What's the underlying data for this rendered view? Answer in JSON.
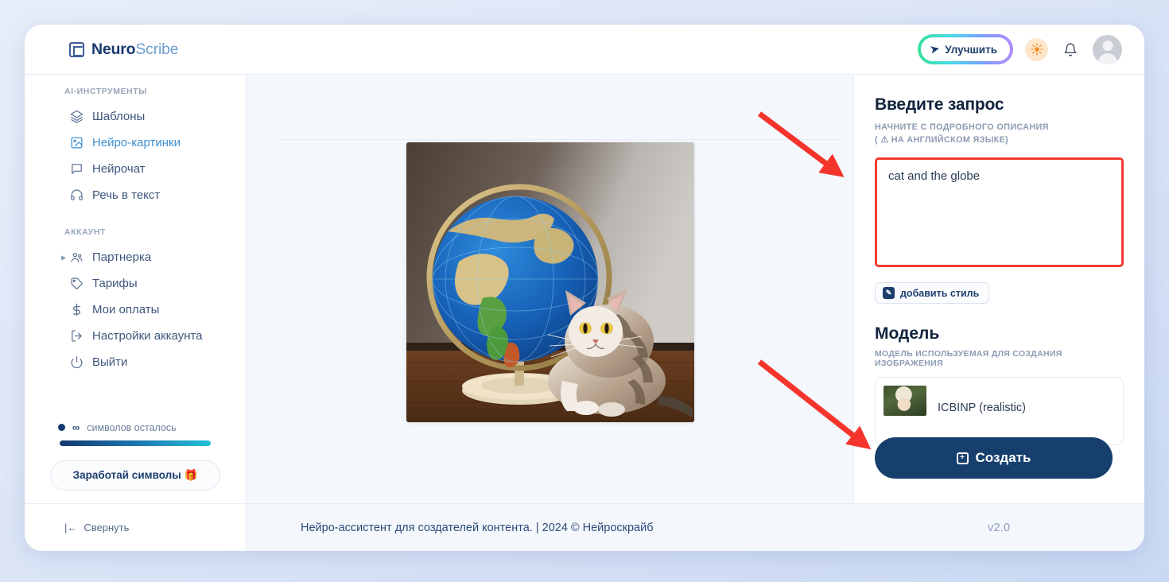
{
  "brand": {
    "name_bold": "Neuro",
    "name_light": "Scribe",
    "logo_icon": "app-square-logo-icon"
  },
  "header": {
    "upgrade_label": "Улучшить",
    "rocket_icon": "rocket-icon",
    "theme_icon": "sun-icon",
    "bell_icon": "bell-icon",
    "avatar_icon": "user-avatar-icon"
  },
  "sidebar": {
    "section_tools_label": "AI-ИНСТРУМЕНТЫ",
    "tools": [
      {
        "label": "Шаблоны",
        "icon": "layers-icon",
        "active": false
      },
      {
        "label": "Нейро-картинки",
        "icon": "image-icon",
        "active": true
      },
      {
        "label": "Нейрочат",
        "icon": "chat-bubble-icon",
        "active": false
      },
      {
        "label": "Речь в текст",
        "icon": "headphones-icon",
        "active": false
      }
    ],
    "section_account_label": "АККАУНТ",
    "account": [
      {
        "label": "Партнерка",
        "icon": "users-icon",
        "expandable": true
      },
      {
        "label": "Тарифы",
        "icon": "tag-icon",
        "expandable": false
      },
      {
        "label": "Мои оплаты",
        "icon": "dollar-icon",
        "expandable": false
      },
      {
        "label": "Настройки аккаунта",
        "icon": "logout-arrow-icon",
        "expandable": false
      },
      {
        "label": "Выйти",
        "icon": "power-icon",
        "expandable": false
      }
    ],
    "credits_value": "∞",
    "credits_label": "символов осталось",
    "earn_button_label": "Заработай символы 🎁",
    "collapse_label": "Свернуть",
    "collapse_icon": "collapse-left-icon"
  },
  "main": {
    "generated_image_alt": "cat-and-globe-generated-image"
  },
  "panel": {
    "prompt_title": "Введите запрос",
    "prompt_subtitle_line1": "НАЧНИТЕ С ПОДРОБНОГО ОПИСАНИЯ",
    "prompt_subtitle_line2_prefix": "(",
    "prompt_subtitle_warning_icon": "warning-triangle-icon",
    "prompt_subtitle_line2": "НА АНГЛИЙСКОМ ЯЗЫКЕ)",
    "prompt_value": "cat and the globe",
    "prompt_placeholder": "",
    "style_button_label": "добавить стиль",
    "style_button_icon": "pencil-square-icon",
    "model_title": "Модель",
    "model_subtitle": "МОДЕЛЬ ИСПОЛЬЗУЕМАЯ ДЛЯ СОЗДАНИЯ ИЗОБРАЖЕНИЯ",
    "model_name": "ICBINP (realistic)",
    "model_thumb_icon": "model-preview-thumbnail",
    "create_button_label": "Создать",
    "create_button_icon": "plus-square-icon"
  },
  "footer": {
    "tagline": "Нейро-ассистент для создателей контента.",
    "copyright": "| 2024 © Нейроскрайб",
    "version": "v2.0"
  },
  "colors": {
    "accent_dark_blue": "#173f6e",
    "accent_link_blue": "#3f8fd0",
    "annotation_red": "#f23b33",
    "page_bg": "#dde6f7"
  }
}
